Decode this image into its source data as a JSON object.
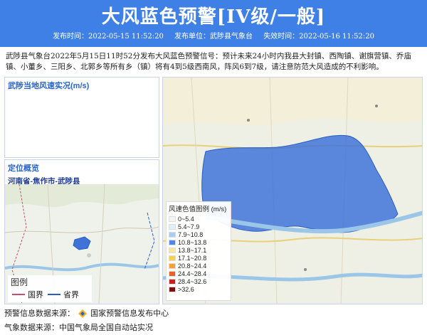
{
  "header": {
    "title": "大风蓝色预警[IV级/一般]",
    "issue_time_label": "发布时间：2022-05-15 11:52:20",
    "issuer_label": "发布单位：武陟县气象台",
    "expire_time_label": "失效时间：2022-05-16 11:52:20"
  },
  "description": "武陟县气象台2022年5月15日11时52分发布大风蓝色预警信号：预计未来24小时内我县大封镇、西陶镇、谢旗营镇、乔庙镇、小董乡、三阳乡、北郭乡等所有乡（镇）将有4到5级西南风，阵风6到7级，请注意防范大风造成的不利影响。",
  "wind_panel": {
    "title": "武陟当地风速实况(m/s)"
  },
  "location_panel": {
    "title": "定位概览",
    "region": "河南省-焦作市-武陟县",
    "legend_title": "图例",
    "legend_items": [
      {
        "label": "国界",
        "color": "#c0506b"
      },
      {
        "label": "省界",
        "color": "#2a5fc0"
      }
    ]
  },
  "wind_legend": {
    "title": "风速色值图例 (m/s)",
    "items": [
      {
        "label": "0~5.4",
        "color": "#f4f4f4"
      },
      {
        "label": "5.4~7.9",
        "color": "#dfeeff"
      },
      {
        "label": "7.9~10.8",
        "color": "#a9ccf7"
      },
      {
        "label": "10.8~13.8",
        "color": "#4f88ea"
      },
      {
        "label": "13.8~17.1",
        "color": "#f8e6a0"
      },
      {
        "label": "17.1~20.8",
        "color": "#f6d24a"
      },
      {
        "label": "20.8~24.4",
        "color": "#f2a134"
      },
      {
        "label": "24.4~28.4",
        "color": "#e5602a"
      },
      {
        "label": "28.4~32.6",
        "color": "#c8201c"
      },
      {
        "label": ">32.6",
        "color": "#7e0f0f"
      }
    ]
  },
  "footer": {
    "source1_prefix": "预警信息数据来源：",
    "source1_name": "国家预警信息发布中心",
    "source2": "气象数据来源：中国气象局全国自动站实况"
  }
}
